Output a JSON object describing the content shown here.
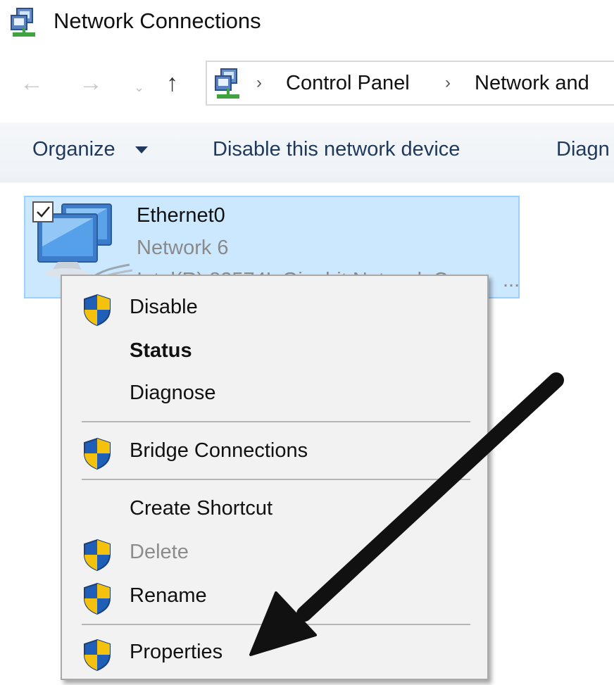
{
  "window": {
    "title": "Network Connections",
    "icon": "network-connections-icon"
  },
  "nav": {
    "back_icon": "arrow-left-icon",
    "forward_icon": "arrow-right-icon",
    "recent_icon": "chevron-down-icon",
    "up_icon": "arrow-up-icon",
    "back_glyph": "←",
    "forward_glyph": "→",
    "recent_glyph": "⌄",
    "up_glyph": "↑"
  },
  "address": {
    "separator": "›",
    "crumbs": [
      "Control Panel",
      "Network and"
    ]
  },
  "toolbar": {
    "organize": "Organize",
    "disable_device": "Disable this network device",
    "diagnose": "Diagn"
  },
  "connection": {
    "name": "Ethernet0",
    "network": "Network  6",
    "adapter": "Intel(R) 82574L Gigabit Network C",
    "ellipsis": "...",
    "checked": true
  },
  "context_menu": {
    "items": [
      {
        "label": "Disable",
        "shield": true,
        "bold": false,
        "disabled": false
      },
      {
        "label": "Status",
        "shield": false,
        "bold": true,
        "disabled": false
      },
      {
        "label": "Diagnose",
        "shield": false,
        "bold": false,
        "disabled": false
      },
      {
        "label": "Bridge Connections",
        "shield": true,
        "bold": false,
        "disabled": false
      },
      {
        "label": "Create Shortcut",
        "shield": false,
        "bold": false,
        "disabled": false
      },
      {
        "label": "Delete",
        "shield": true,
        "bold": false,
        "disabled": true
      },
      {
        "label": "Rename",
        "shield": true,
        "bold": false,
        "disabled": false
      },
      {
        "label": "Properties",
        "shield": true,
        "bold": false,
        "disabled": false
      }
    ]
  },
  "colors": {
    "selection_bg": "#cce8ff",
    "selection_border": "#99d1ff",
    "menu_bg": "#f2f2f2",
    "toolbar_text": "#1e395b",
    "shield_blue": "#1f5fb8",
    "shield_yellow": "#f4c20d",
    "arrow": "#111111"
  }
}
